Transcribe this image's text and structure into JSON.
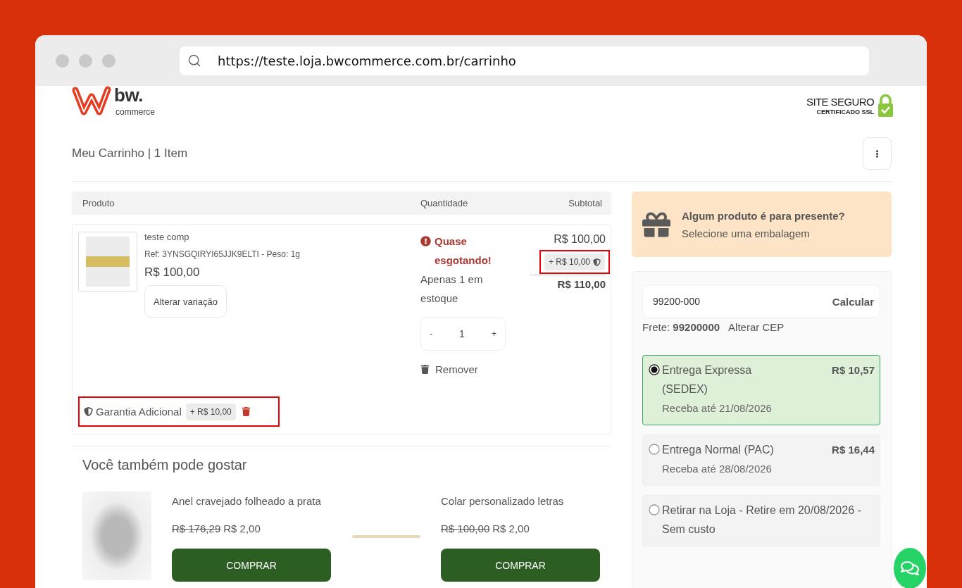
{
  "browser": {
    "url": "https://teste.loja.bwcommerce.com.br/carrinho"
  },
  "header": {
    "logo": {
      "wordmark": "bw.",
      "tagline": "commerce"
    },
    "security_seal": {
      "title": "SITE SEGURO",
      "subtitle": "CERTIFICADO SSL"
    }
  },
  "page_title": "Meu Carrinho | 1 Item",
  "cart": {
    "columns": [
      "Produto",
      "Quantidade",
      "Subtotal"
    ],
    "items": [
      {
        "name": "teste comp",
        "ref": "Ref: 3YNSGQIRYI65JJK9ELTI - Peso: 1g",
        "price": "R$ 100,00",
        "change_variation": "Alterar variação",
        "stock_alert": "Quase esgotando!",
        "stock_note": "Apenas 1 em estoque",
        "decrease": "-",
        "quantity": "1",
        "increase": "+",
        "remove": "Remover",
        "subtotal": "R$ 100,00",
        "addon": {
          "amount": "+ R$ 10,00",
          "highlighted": true
        },
        "total": "R$ 110,00",
        "warranty": {
          "label": "Garantia Adicional",
          "amount": "+ R$ 10,00",
          "highlighted": true
        }
      }
    ]
  },
  "recommendations": {
    "title": "Você também pode gostar",
    "products": [
      {
        "kind": "block",
        "name": "Anel cravejado folheado a prata",
        "old_price": "R$ 176,29",
        "price": "R$ 2,00",
        "button": "COMPRAR"
      },
      {
        "kind": "line",
        "name": "Colar personalizado letras",
        "old_price": "R$ 100,00",
        "price": "R$ 2,00",
        "button": "COMPRAR"
      }
    ]
  },
  "gift": {
    "title": "Algum produto é para presente?",
    "subtitle": "Selecione uma embalagem"
  },
  "shipping": {
    "cep_value": "99200-000",
    "calculate": "Calcular",
    "freight": "Frete: **99200000**",
    "change_cep": "Alterar CEP",
    "options": [
      {
        "title": "Entrega Expressa (SEDEX)",
        "price": "R$ 10,57",
        "eta": "Receba até 21/08/2026",
        "selected": true
      },
      {
        "title": "Entrega Normal (PAC)",
        "price": "R$ 16,44",
        "eta": "Receba até 28/08/2026",
        "selected": false
      },
      {
        "title": "Retirar na Loja - Retire em 20/08/2026 - Sem custo",
        "selected": false
      }
    ]
  }
}
